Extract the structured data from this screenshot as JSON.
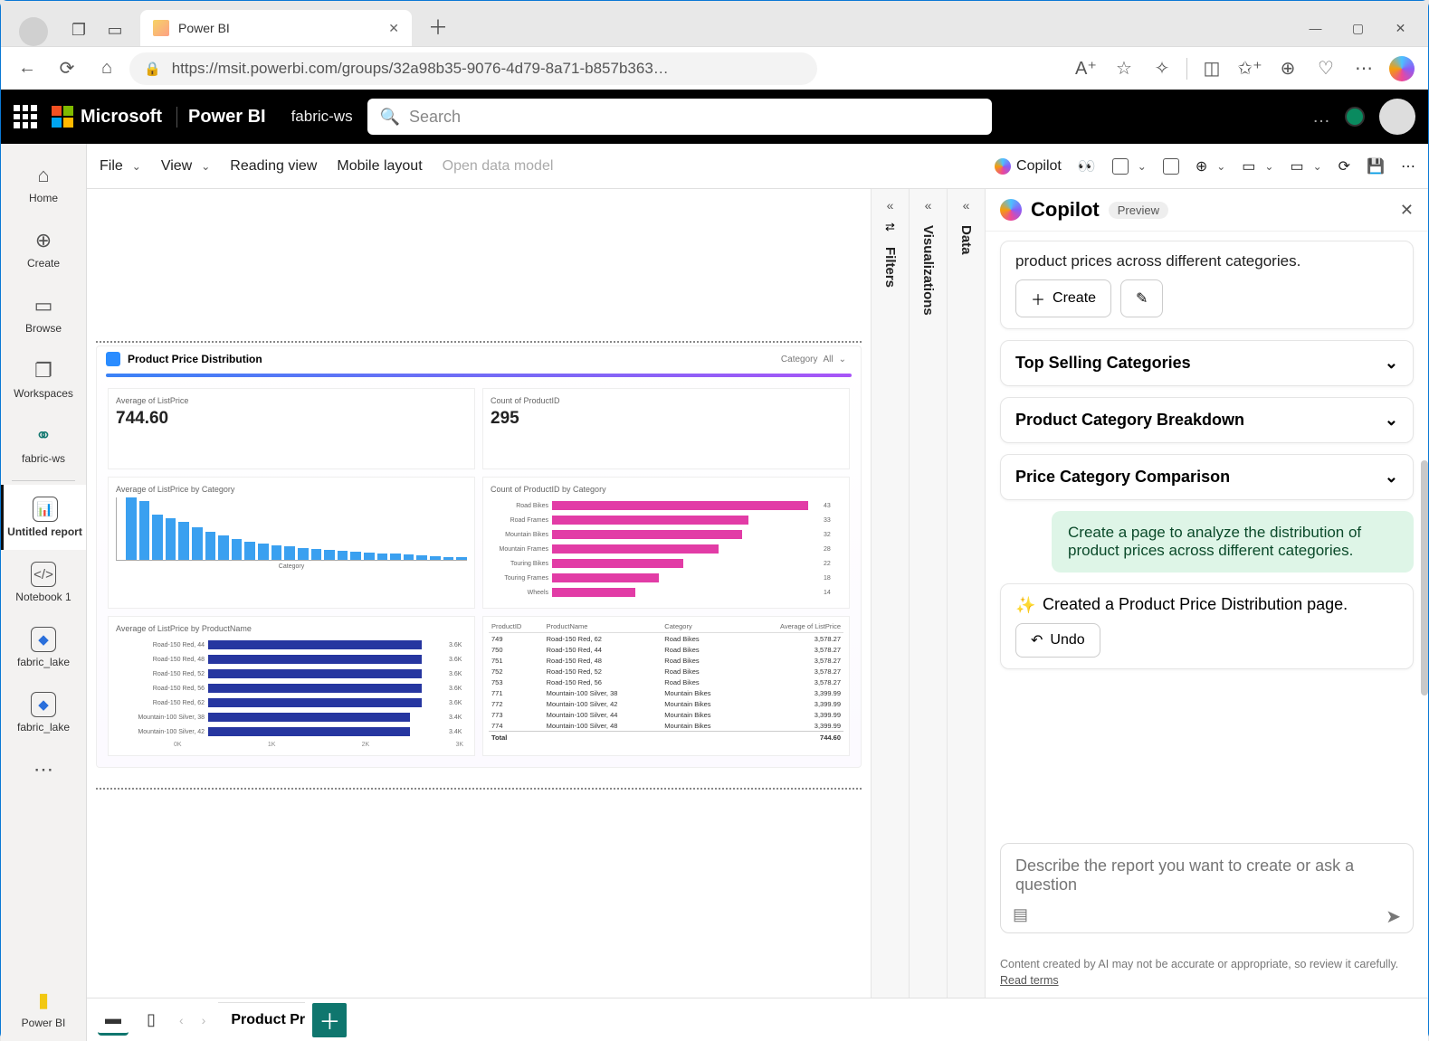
{
  "browser": {
    "tab_title": "Power BI",
    "url": "https://msit.powerbi.com/groups/32a98b35-9076-4d79-8a71-b857b363…"
  },
  "header": {
    "brand": "Microsoft",
    "app": "Power BI",
    "workspace": "fabric-ws",
    "search_placeholder": "Search"
  },
  "left_rail": {
    "items": [
      "Home",
      "Create",
      "Browse",
      "Workspaces",
      "fabric-ws",
      "Untitled report",
      "Notebook 1",
      "fabric_lake",
      "fabric_lake"
    ],
    "footer": "Power BI"
  },
  "toolbar": {
    "file": "File",
    "view": "View",
    "reading": "Reading view",
    "mobile": "Mobile layout",
    "open_model": "Open data model",
    "copilot": "Copilot"
  },
  "panes": {
    "filters": "Filters",
    "viz": "Visualizations",
    "data": "Data"
  },
  "report": {
    "title": "Product Price Distribution",
    "filter_label": "Category",
    "filter_value": "All",
    "cards": {
      "avg_listprice": {
        "title": "Average of ListPrice",
        "value": "744.60"
      },
      "count_product": {
        "title": "Count of ProductID",
        "value": "295"
      },
      "avg_by_cat": "Average of ListPrice by Category",
      "count_by_cat": "Count of ProductID by Category",
      "avg_by_name": "Average of ListPrice by ProductName",
      "axis_label_category": "Category"
    },
    "table": {
      "headers": [
        "ProductID",
        "ProductName",
        "Category",
        "Average of ListPrice"
      ],
      "rows": [
        [
          "749",
          "Road-150 Red, 62",
          "Road Bikes",
          "3,578.27"
        ],
        [
          "750",
          "Road-150 Red, 44",
          "Road Bikes",
          "3,578.27"
        ],
        [
          "751",
          "Road-150 Red, 48",
          "Road Bikes",
          "3,578.27"
        ],
        [
          "752",
          "Road-150 Red, 52",
          "Road Bikes",
          "3,578.27"
        ],
        [
          "753",
          "Road-150 Red, 56",
          "Road Bikes",
          "3,578.27"
        ],
        [
          "771",
          "Mountain-100 Silver, 38",
          "Mountain Bikes",
          "3,399.99"
        ],
        [
          "772",
          "Mountain-100 Silver, 42",
          "Mountain Bikes",
          "3,399.99"
        ],
        [
          "773",
          "Mountain-100 Silver, 44",
          "Mountain Bikes",
          "3,399.99"
        ],
        [
          "774",
          "Mountain-100 Silver, 48",
          "Mountain Bikes",
          "3,399.99"
        ]
      ],
      "total_label": "Total",
      "total_value": "744.60"
    }
  },
  "chart_data": [
    {
      "type": "bar",
      "title": "Average of ListPrice by Category",
      "ylabel": "",
      "xlabel": "Category",
      "ylim": [
        0,
        2000
      ],
      "categories": [
        "",
        "",
        "",
        "",
        "",
        "",
        "",
        "",
        "",
        "",
        "",
        "",
        "",
        "",
        "",
        "",
        "",
        "",
        "",
        "",
        "",
        "",
        "",
        "",
        "",
        ""
      ],
      "values": [
        1800,
        1700,
        1300,
        1200,
        1100,
        950,
        800,
        700,
        600,
        520,
        480,
        420,
        380,
        350,
        320,
        290,
        260,
        240,
        210,
        190,
        170,
        150,
        130,
        110,
        90,
        70
      ]
    },
    {
      "type": "bar_horizontal",
      "title": "Count of ProductID by Category",
      "xlabel": "",
      "ylabel": "Category",
      "xlim": [
        0,
        45
      ],
      "categories": [
        "Road Bikes",
        "Road Frames",
        "Mountain Bikes",
        "Mountain Frames",
        "Touring Bikes",
        "Touring Frames",
        "Wheels"
      ],
      "values": [
        43,
        33,
        32,
        28,
        22,
        18,
        14
      ]
    },
    {
      "type": "bar_horizontal",
      "title": "Average of ListPrice by ProductName",
      "xlabel": "",
      "ylabel": "ProductName",
      "xlim": [
        0,
        4000
      ],
      "categories": [
        "Road-150 Red, 44",
        "Road-150 Red, 48",
        "Road-150 Red, 52",
        "Road-150 Red, 56",
        "Road-150 Red, 62",
        "Mountain-100 Silver, 38",
        "Mountain-100 Silver, 42"
      ],
      "values": [
        3600,
        3600,
        3600,
        3600,
        3600,
        3400,
        3400
      ],
      "value_labels": [
        "3.6K",
        "3.6K",
        "3.6K",
        "3.6K",
        "3.6K",
        "3.4K",
        "3.4K"
      ]
    }
  ],
  "copilot": {
    "title": "Copilot",
    "badge": "Preview",
    "intro_tail": "product prices across different categories.",
    "create_btn": "Create",
    "suggestions": [
      "Top Selling Categories",
      "Product Category Breakdown",
      "Price Category Comparison"
    ],
    "user_prompt": "Create a page to analyze the distribution of product prices across different categories.",
    "ai_status": "Created a Product Price Distribution page.",
    "undo": "Undo",
    "input_placeholder": "Describe the report you want to create or ask a question",
    "disclaimer": "Content created by AI may not be accurate or appropriate, so review it carefully.",
    "terms": "Read terms"
  },
  "page_tabs": {
    "active": "Product Pr"
  }
}
